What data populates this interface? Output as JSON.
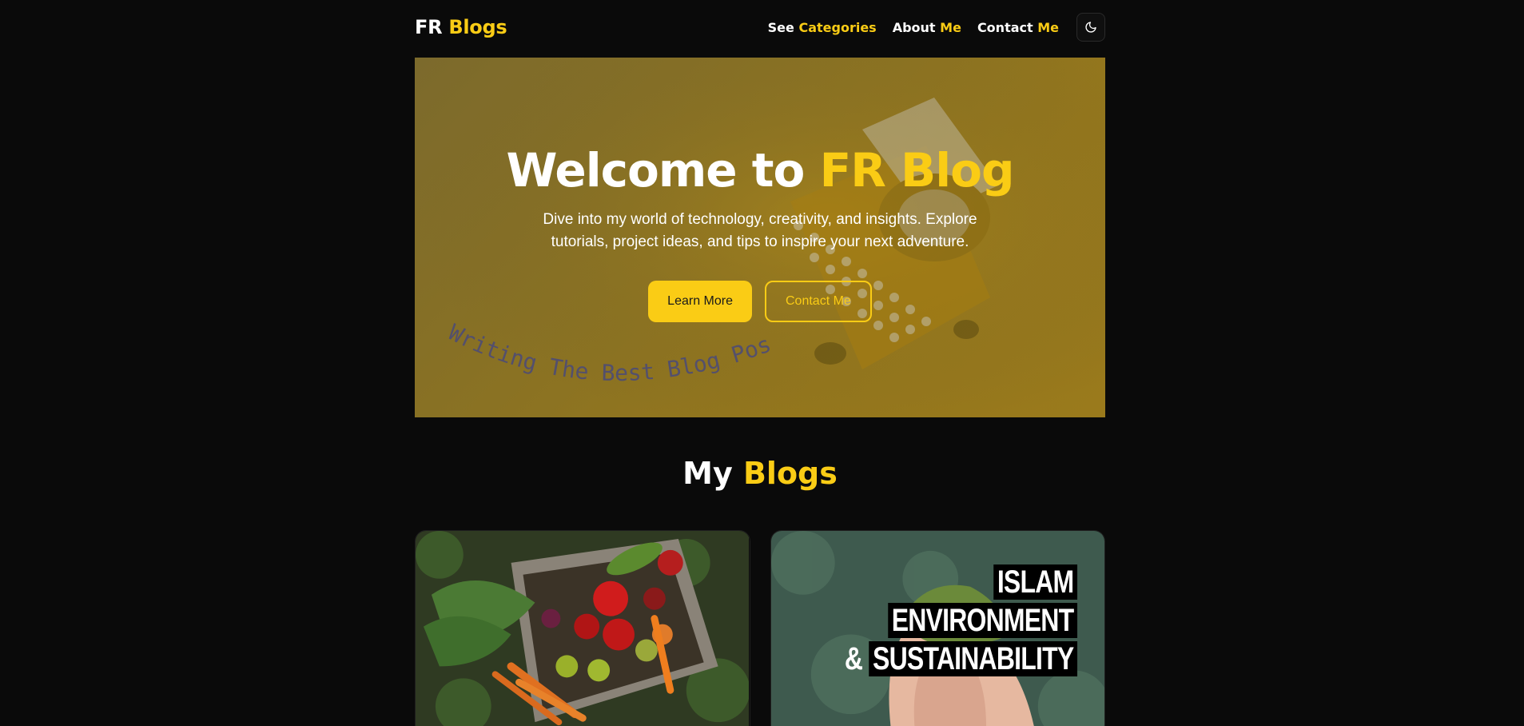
{
  "nav": {
    "logo": {
      "first": "FR",
      "second": "Blogs"
    },
    "links": [
      {
        "first": "See",
        "second": "Categories"
      },
      {
        "first": "About",
        "second": "Me"
      },
      {
        "first": "Contact",
        "second": "Me"
      }
    ],
    "theme_toggle_icon": "moon-icon"
  },
  "hero": {
    "title": {
      "first": "Welcome to",
      "second": "FR Blog"
    },
    "description": "Dive into my world of technology, creativity, and insights. Explore tutorials, project ideas, and tips to inspire your next adventure.",
    "primary_button": "Learn More",
    "secondary_button": "Contact Me",
    "curved_text": "Writing The Best Blog Post"
  },
  "blogs_section": {
    "title": {
      "first": "My",
      "second": "Blogs"
    }
  },
  "cards": [
    {
      "image": "vegetable-crate-image"
    },
    {
      "image": "hands-holding-earth-image",
      "overlay_lines": [
        "ISLAM",
        "ENVIRONMENT",
        "&",
        "SUSTAINABILITY"
      ]
    }
  ],
  "colors": {
    "background": "#0a0a0a",
    "accent": "#facc15",
    "text": "#ffffff"
  }
}
